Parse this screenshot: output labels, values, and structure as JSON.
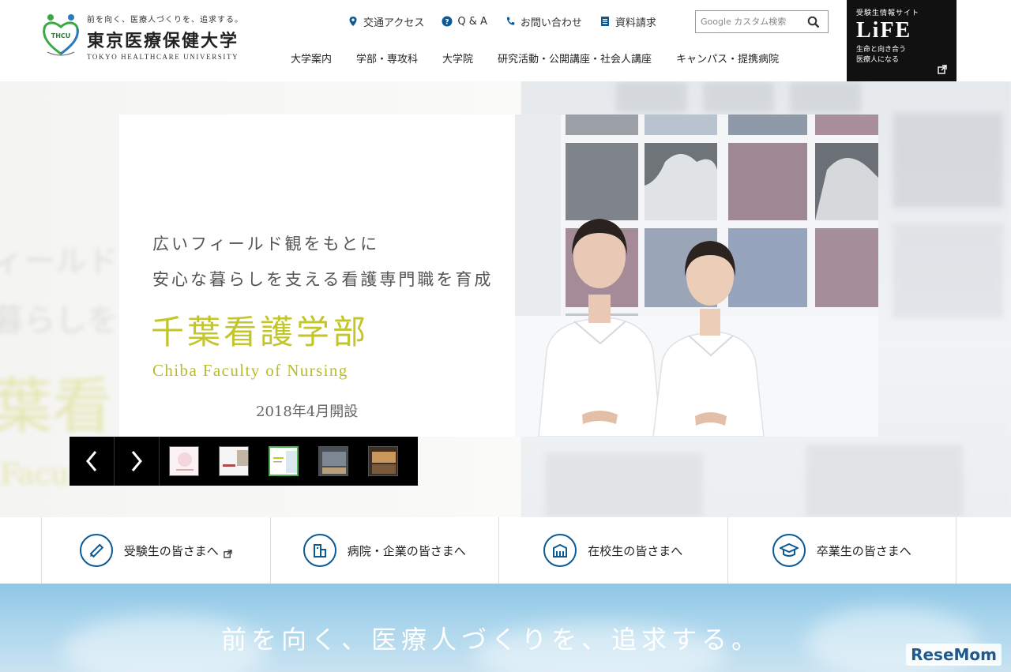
{
  "header": {
    "logo": {
      "tagline": "前を向く、医療人づくりを、追求する。",
      "name": "東京医療保健大学",
      "name_en": "TOKYO HEALTHCARE UNIVERSITY",
      "mark_text": "THCU"
    },
    "util_nav": [
      {
        "label": "交通アクセス",
        "icon": "map-pin-icon"
      },
      {
        "label": "Q & A",
        "icon": "question-circle-icon"
      },
      {
        "label": "お問い合わせ",
        "icon": "phone-icon"
      },
      {
        "label": "資料請求",
        "icon": "document-icon"
      }
    ],
    "search": {
      "placeholder": "カスタム検索",
      "brand": "Google"
    },
    "main_nav": [
      "大学案内",
      "学部・専攻科",
      "大学院",
      "研究活動・公開講座・社会人講座",
      "キャンパス・提携病院"
    ],
    "life_banner": {
      "top": "受験生情報サイト",
      "logo": "LiFE",
      "sub1": "生命と向き合う",
      "sub2": "医療人になる"
    }
  },
  "hero": {
    "line1": "広いフィールド観をもとに",
    "line2": "安心な暮らしを支える看護専門職を育成",
    "title": "千葉看護学部",
    "title_en": "Chiba  Faculty  of  Nursing",
    "date": "2018年4月開設",
    "ghost": {
      "g1": "ィールド",
      "g2": "暮らしを",
      "g3": "葉看",
      "g4": "Facu"
    },
    "slider": {
      "prev": "‹",
      "next": "›",
      "active_index": 2,
      "thumb_count": 5
    }
  },
  "audience": [
    {
      "label": "受験生の皆さまへ",
      "icon": "pencil-icon",
      "external": true
    },
    {
      "label": "病院・企業の皆さまへ",
      "icon": "hospital-icon",
      "external": false
    },
    {
      "label": "在校生の皆さまへ",
      "icon": "school-building-icon",
      "external": false
    },
    {
      "label": "卒業生の皆さまへ",
      "icon": "graduation-cap-icon",
      "external": false
    }
  ],
  "motto": {
    "text": "前を向く、医療人づくりを、追求する。"
  },
  "watermark": "ReseMom",
  "colors": {
    "accent_blue": "#0c5a93",
    "title_yellow": "#c3c62a",
    "life_bg": "#111111",
    "sky": "#8fc7e6"
  }
}
